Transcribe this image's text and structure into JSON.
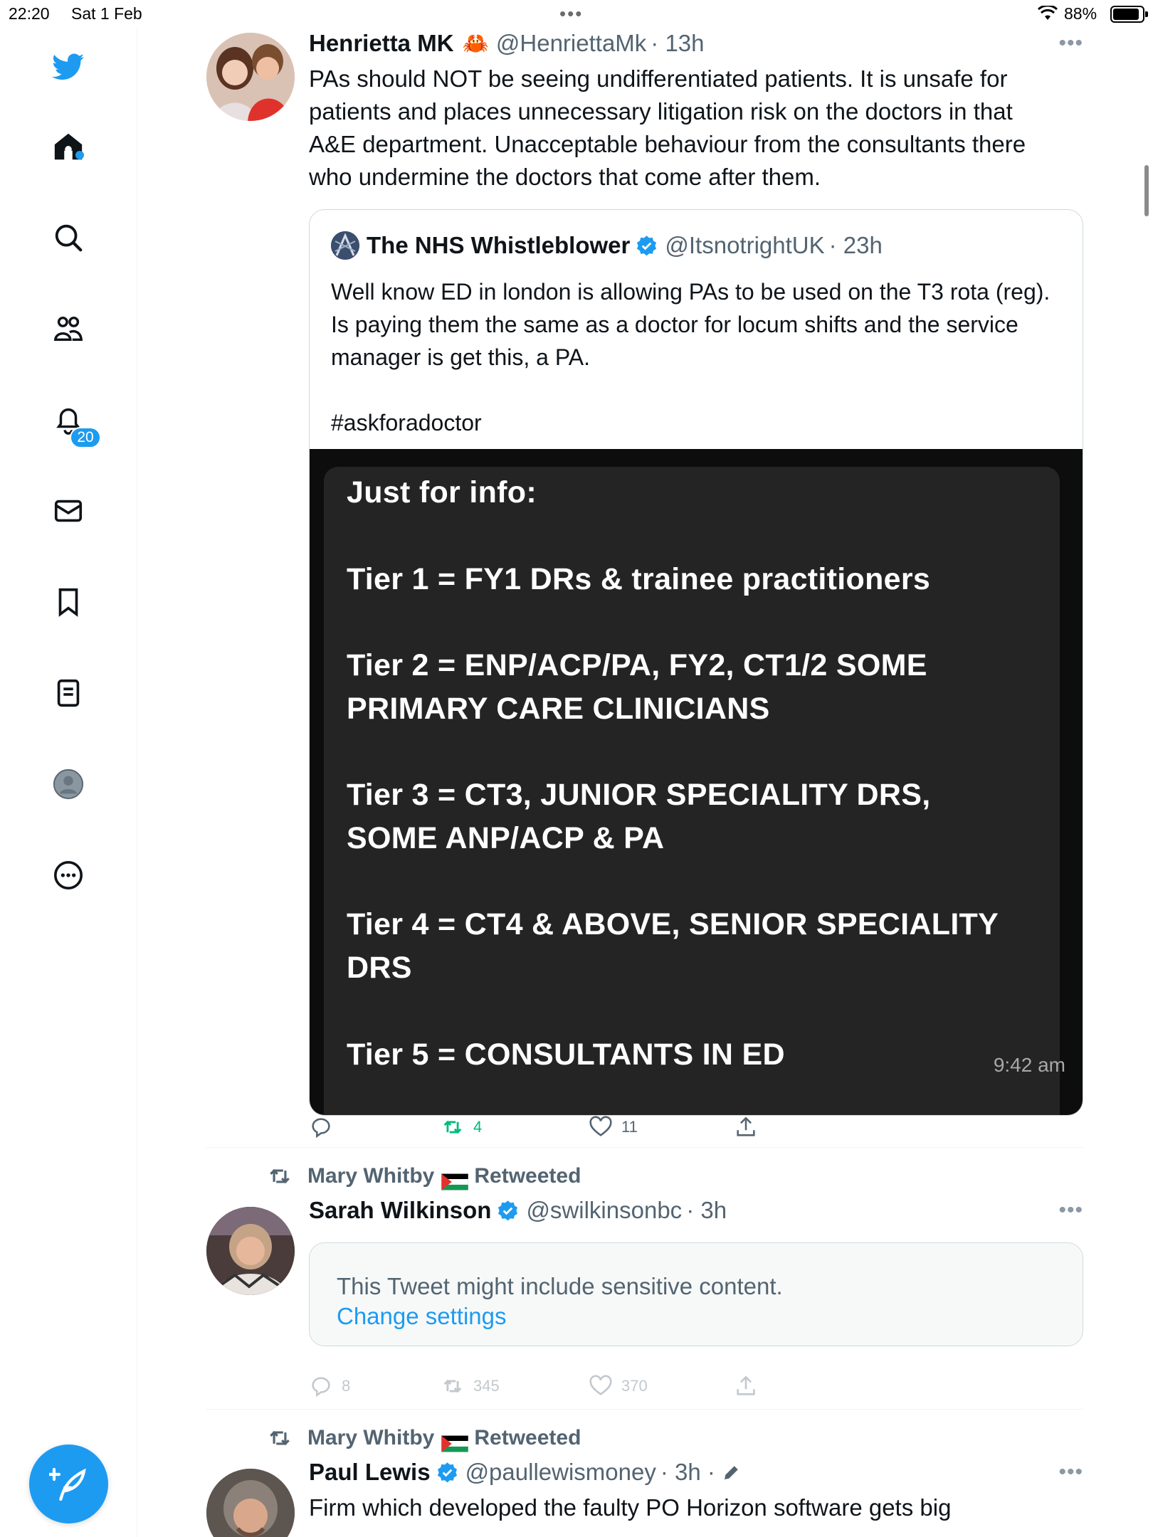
{
  "status_bar": {
    "time": "22:20",
    "date": "Sat 1 Feb",
    "battery_percent": "88%",
    "battery_level": 0.88
  },
  "sidebar": {
    "notifications_badge": "20",
    "items": [
      "twitter-logo",
      "home",
      "search",
      "communities",
      "notifications",
      "messages",
      "bookmarks",
      "lists",
      "profile",
      "more"
    ]
  },
  "colors": {
    "accent": "#1d9bf0",
    "retweet_green": "#00ba7c",
    "text_primary": "#0f1419",
    "text_secondary": "#536471"
  },
  "tweets": [
    {
      "name": "Henrietta MK",
      "name_emoji": "🦀",
      "handle": "@HenriettaMk",
      "time": "· 13h",
      "text": "PAs should NOT be seeing undifferentiated patients. It is unsafe for patients and places unnecessary litigation risk on the doctors in that A&E department. Unacceptable behaviour from the consultants there who undermine the doctors that come after them.",
      "quote": {
        "name": "The NHS Whistleblower",
        "handle": "@ItsnotrightUK",
        "time": "· 23h",
        "text": "Well know ED in london is allowing PAs to be used on the T3 rota (reg). Is paying them the same as a doctor for locum shifts and the service manager is get this, a PA.",
        "hashtag": "#askforadoctor",
        "image": {
          "lines": [
            "Just for info:",
            "Tier 1 = FY1 DRs & trainee practitioners",
            "Tier 2 = ENP/ACP/PA, FY2, CT1/2 SOME",
            "PRIMARY CARE CLINICIANS",
            "Tier 3 = CT3, JUNIOR SPECIALITY DRS,",
            "SOME ANP/ACP & PA",
            "Tier 4 = CT4 & ABOVE, SENIOR SPECIALITY",
            "DRS",
            "Tier 5 = CONSULTANTS IN ED"
          ],
          "timestamp": "9:42 am"
        }
      },
      "retweets": "4",
      "likes": "11"
    },
    {
      "retweeted_by": "Mary Whitby",
      "retweeted_label": "Retweeted",
      "name": "Sarah Wilkinson",
      "handle": "@swilkinsonbc",
      "time": "· 3h",
      "sensitive_message": "This Tweet might include sensitive content.",
      "sensitive_link": "Change settings",
      "replies": "8",
      "retweets": "345",
      "likes": "370"
    },
    {
      "retweeted_by": "Mary Whitby",
      "retweeted_label": "Retweeted",
      "name": "Paul Lewis",
      "handle": "@paullewismoney",
      "time": "· 3h ·",
      "text": "Firm which developed the faulty PO Horizon software gets big"
    }
  ]
}
